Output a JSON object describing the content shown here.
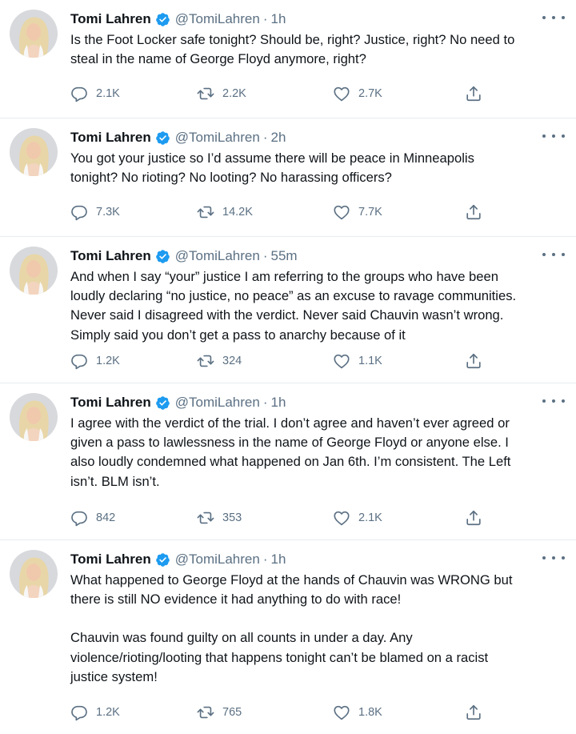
{
  "author": {
    "name": "Tomi Lahren",
    "handle": "@TomiLahren"
  },
  "tweets": [
    {
      "time": "1h",
      "paragraphs": [
        "Is the Foot Locker safe tonight? Should be, right? Justice, right? No need to\nsteal in the name of George Floyd anymore, right?"
      ],
      "replies": "2.1K",
      "retweets": "2.2K",
      "likes": "2.7K"
    },
    {
      "time": "2h",
      "paragraphs": [
        "You got your justice so I’d assume there will be peace in Minneapolis\ntonight? No rioting? No looting? No harassing officers?"
      ],
      "replies": "7.3K",
      "retweets": "14.2K",
      "likes": "7.7K"
    },
    {
      "time": "55m",
      "paragraphs": [
        "And when I say “your” justice I am referring to the groups who have been\nloudly declaring “no justice, no peace” as an excuse to ravage communities.\nNever said I disagreed with the verdict. Never said Chauvin wasn’t wrong.\nSimply said you don’t get a pass to anarchy because of it"
      ],
      "replies": "1.2K",
      "retweets": "324",
      "likes": "1.1K"
    },
    {
      "time": "1h",
      "paragraphs": [
        "I agree with the verdict of the trial. I don’t agree and haven’t ever agreed or\ngiven a pass to lawlessness in the name of George Floyd or anyone else. I\nalso loudly condemned what happened on Jan 6th. I’m consistent. The Left\nisn’t. BLM isn’t."
      ],
      "replies": "842",
      "retweets": "353",
      "likes": "2.1K"
    },
    {
      "time": "1h",
      "paragraphs": [
        "What happened to George Floyd at the hands of Chauvin was WRONG but\nthere is still NO evidence it had anything to do with race!",
        "Chauvin was found guilty on all counts in under a day. Any\nviolence/rioting/looting that happens tonight can’t be blamed on a racist\njustice system!"
      ],
      "replies": "1.2K",
      "retweets": "765",
      "likes": "1.8K"
    }
  ],
  "icons": {
    "reply": "reply-icon",
    "retweet": "retweet-icon",
    "like": "heart-icon",
    "share": "share-icon",
    "verified": "verified-badge-icon",
    "more": "more-options-icon"
  },
  "colors": {
    "verified": "#1d9bf0",
    "icon": "#5b7083",
    "text": "#0f1419",
    "divider": "#e6ecf0"
  }
}
